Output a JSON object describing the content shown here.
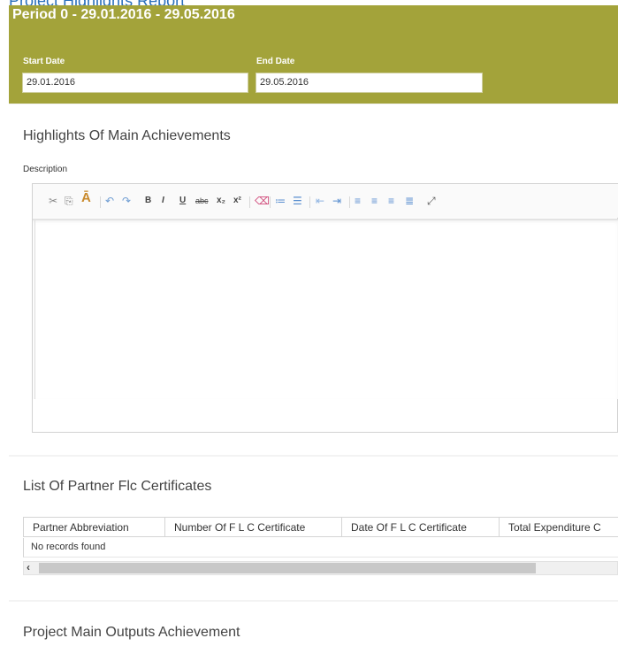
{
  "top_heading_partial": "Project Highlights Report",
  "period": {
    "title": "Period 0 - 29.01.2016 - 29.05.2016",
    "start_label": "Start Date",
    "start_value": "29.01.2016",
    "end_label": "End Date",
    "end_value": "29.05.2016"
  },
  "highlights": {
    "title": "Highlights Of Main Achievements",
    "description_label": "Description",
    "editor_value": ""
  },
  "toolbar": {
    "icons": [
      "cut-icon",
      "copy-icon",
      "paste-text-icon",
      "undo-icon",
      "redo-icon",
      "bold-icon",
      "italic-icon",
      "underline-icon",
      "strikethrough-icon",
      "subscript-icon",
      "superscript-icon",
      "remove-format-icon",
      "numbered-list-icon",
      "bulleted-list-icon",
      "outdent-icon",
      "indent-icon",
      "align-left-icon",
      "align-center-icon",
      "align-right-icon",
      "justify-icon",
      "maximize-icon"
    ],
    "bold": "B",
    "italic": "I",
    "underline": "U",
    "strike": "abc",
    "subscript": "x₂",
    "superscript": "x²"
  },
  "certificates": {
    "title": "List Of Partner Flc Certificates",
    "columns": [
      "Partner Abbreviation",
      "Number Of F L C Certificate",
      "Date Of F L C Certificate",
      "Total Expenditure C"
    ],
    "empty_message": "No records found"
  },
  "outputs": {
    "title": "Project Main Outputs Achievement"
  }
}
